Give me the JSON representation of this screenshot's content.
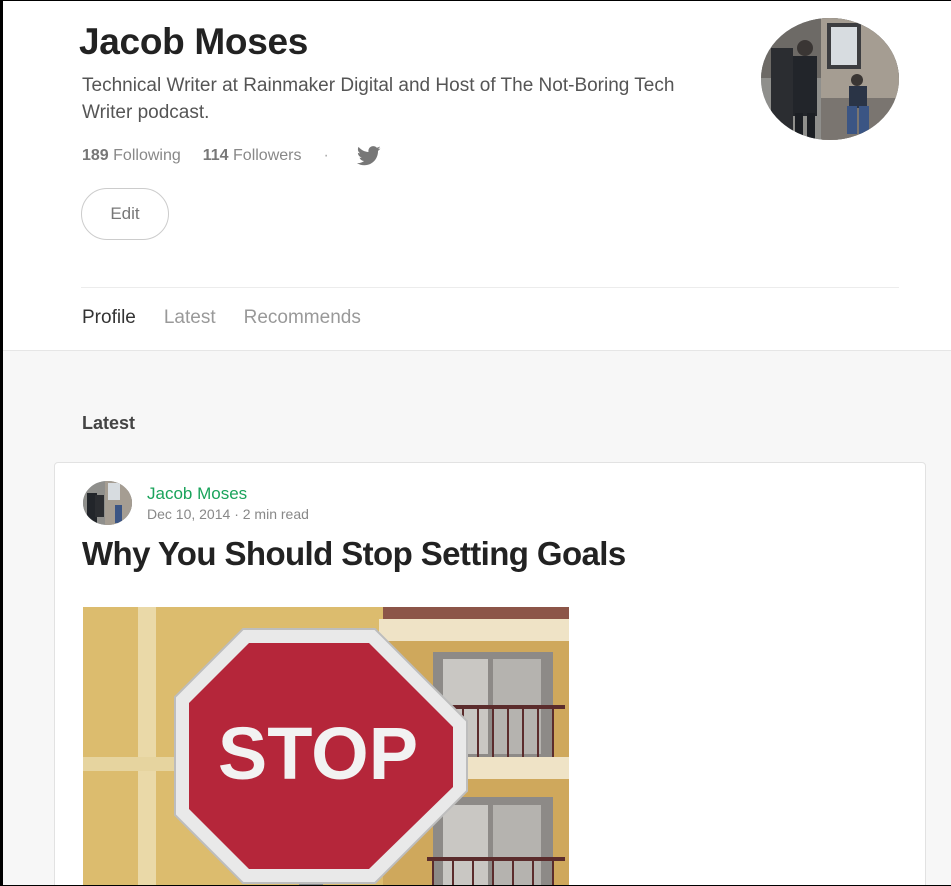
{
  "profile": {
    "name": "Jacob Moses",
    "bio": "Technical Writer at Rainmaker Digital and Host of The Not-Boring Tech Writer podcast.",
    "following_count": "189",
    "following_label": "Following",
    "followers_count": "114",
    "followers_label": "Followers",
    "separator": "·",
    "twitter_icon": "twitter-icon",
    "edit_label": "Edit"
  },
  "tabs": [
    {
      "label": "Profile",
      "active": true
    },
    {
      "label": "Latest",
      "active": false
    },
    {
      "label": "Recommends",
      "active": false
    }
  ],
  "latest": {
    "section_title": "Latest",
    "post": {
      "author": "Jacob Moses",
      "date": "Dec 10, 2014",
      "dot": "·",
      "read_time": "2 min read",
      "title": "Why You Should Stop Setting Goals",
      "image_sign_text": "STOP"
    }
  },
  "colors": {
    "author_green": "#1aa35b",
    "stop_red": "#b5263a"
  }
}
